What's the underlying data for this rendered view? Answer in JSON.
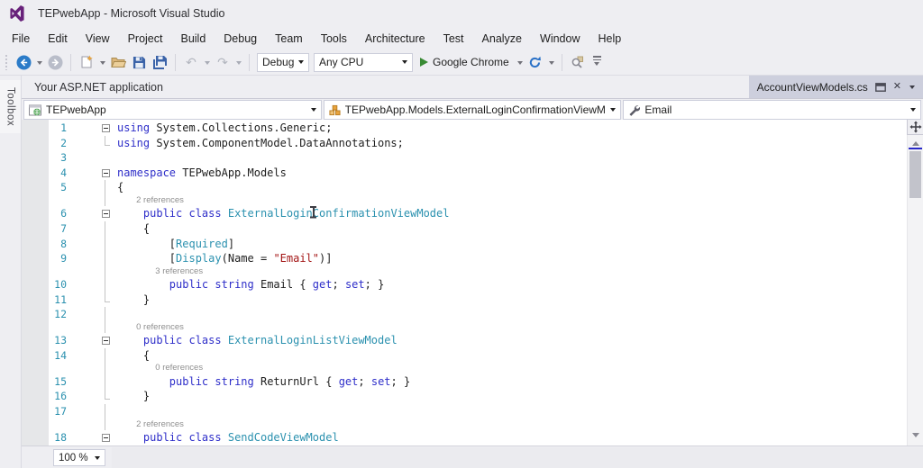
{
  "window": {
    "title": "TEPwebApp - Microsoft Visual Studio"
  },
  "menu": {
    "items": [
      "File",
      "Edit",
      "View",
      "Project",
      "Build",
      "Debug",
      "Team",
      "Tools",
      "Architecture",
      "Test",
      "Analyze",
      "Window",
      "Help"
    ]
  },
  "toolbar": {
    "config_value": "Debug",
    "platform_value": "Any CPU",
    "run_label": "Google Chrome"
  },
  "tabs": {
    "left_tab": "Your ASP.NET application",
    "right_tab": "AccountViewModels.cs"
  },
  "navbar": {
    "project": "TEPwebApp",
    "type": "TEPwebApp.Models.ExternalLoginConfirmationViewModel",
    "member": "Email"
  },
  "sidebar": {
    "toolbox_label": "Toolbox"
  },
  "statusbar": {
    "zoom_value": "100 %"
  },
  "icons": {
    "undo": "↶",
    "redo": "↷",
    "close": "✕"
  },
  "colors": {
    "chrome_bg": "#eeeef2",
    "border": "#cccedb",
    "keyword": "#2e2ec9",
    "type_name": "#2b91af",
    "string": "#a31515",
    "line_number": "#2b91af",
    "codelens": "#8f8f8f",
    "run_green": "#388a34",
    "accent_logo": "#68217a"
  },
  "editor": {
    "lines": [
      {
        "num": "1",
        "outline": "box",
        "indent": 0,
        "code": [
          [
            "kw",
            "using"
          ],
          [
            "pl",
            " System.Collections.Generic;"
          ]
        ]
      },
      {
        "num": "2",
        "outline": "end",
        "indent": 0,
        "code": [
          [
            "kw",
            "using"
          ],
          [
            "pl",
            " System.ComponentModel.DataAnnotations;"
          ]
        ]
      },
      {
        "num": "3",
        "outline": "none",
        "indent": 0,
        "code": []
      },
      {
        "num": "4",
        "outline": "box",
        "indent": 0,
        "code": [
          [
            "kw",
            "namespace"
          ],
          [
            "pl",
            " TEPwebApp.Models"
          ]
        ]
      },
      {
        "num": "5",
        "outline": "line",
        "indent": 0,
        "code": [
          [
            "pl",
            "{"
          ]
        ]
      },
      {
        "num": "6",
        "outline": "box",
        "indent": 4,
        "codelens": "2 references",
        "code": [
          [
            "kw",
            "public"
          ],
          [
            "pl",
            " "
          ],
          [
            "kw",
            "class"
          ],
          [
            "pl",
            " "
          ],
          [
            "ty",
            "ExternalLoginConfirmationViewModel"
          ]
        ]
      },
      {
        "num": "7",
        "outline": "line",
        "indent": 4,
        "code": [
          [
            "pl",
            "{"
          ]
        ]
      },
      {
        "num": "8",
        "outline": "line",
        "indent": 8,
        "code": [
          [
            "pl",
            "["
          ],
          [
            "ty",
            "Required"
          ],
          [
            "pl",
            "]"
          ]
        ]
      },
      {
        "num": "9",
        "outline": "line",
        "indent": 8,
        "code": [
          [
            "pl",
            "["
          ],
          [
            "ty",
            "Display"
          ],
          [
            "pl",
            "("
          ],
          [
            "pl",
            "Name"
          ],
          [
            "pl",
            " = "
          ],
          [
            "st",
            "\"Email\""
          ],
          [
            "pl",
            ")]"
          ]
        ]
      },
      {
        "num": "10",
        "outline": "line",
        "indent": 8,
        "codelens": "3 references",
        "code": [
          [
            "kw",
            "public"
          ],
          [
            "pl",
            " "
          ],
          [
            "kw",
            "string"
          ],
          [
            "pl",
            " "
          ],
          [
            "pl",
            "Email"
          ],
          [
            "pl",
            " { "
          ],
          [
            "kw",
            "get"
          ],
          [
            "pl",
            "; "
          ],
          [
            "kw",
            "set"
          ],
          [
            "pl",
            "; }"
          ]
        ]
      },
      {
        "num": "11",
        "outline": "end",
        "indent": 4,
        "code": [
          [
            "pl",
            "}"
          ]
        ]
      },
      {
        "num": "12",
        "outline": "line",
        "indent": 0,
        "code": []
      },
      {
        "num": "13",
        "outline": "box",
        "indent": 4,
        "codelens": "0 references",
        "code": [
          [
            "kw",
            "public"
          ],
          [
            "pl",
            " "
          ],
          [
            "kw",
            "class"
          ],
          [
            "pl",
            " "
          ],
          [
            "ty",
            "ExternalLoginListViewModel"
          ]
        ]
      },
      {
        "num": "14",
        "outline": "line",
        "indent": 4,
        "code": [
          [
            "pl",
            "{"
          ]
        ]
      },
      {
        "num": "15",
        "outline": "line",
        "indent": 8,
        "codelens": "0 references",
        "code": [
          [
            "kw",
            "public"
          ],
          [
            "pl",
            " "
          ],
          [
            "kw",
            "string"
          ],
          [
            "pl",
            " "
          ],
          [
            "pl",
            "ReturnUrl"
          ],
          [
            "pl",
            " { "
          ],
          [
            "kw",
            "get"
          ],
          [
            "pl",
            "; "
          ],
          [
            "kw",
            "set"
          ],
          [
            "pl",
            "; }"
          ]
        ]
      },
      {
        "num": "16",
        "outline": "end",
        "indent": 4,
        "code": [
          [
            "pl",
            "}"
          ]
        ]
      },
      {
        "num": "17",
        "outline": "line",
        "indent": 0,
        "code": []
      },
      {
        "num": "18",
        "outline": "box",
        "indent": 4,
        "codelens": "2 references",
        "code": [
          [
            "kw",
            "public"
          ],
          [
            "pl",
            " "
          ],
          [
            "kw",
            "class"
          ],
          [
            "pl",
            " "
          ],
          [
            "ty",
            "SendCodeViewModel"
          ]
        ]
      }
    ]
  }
}
